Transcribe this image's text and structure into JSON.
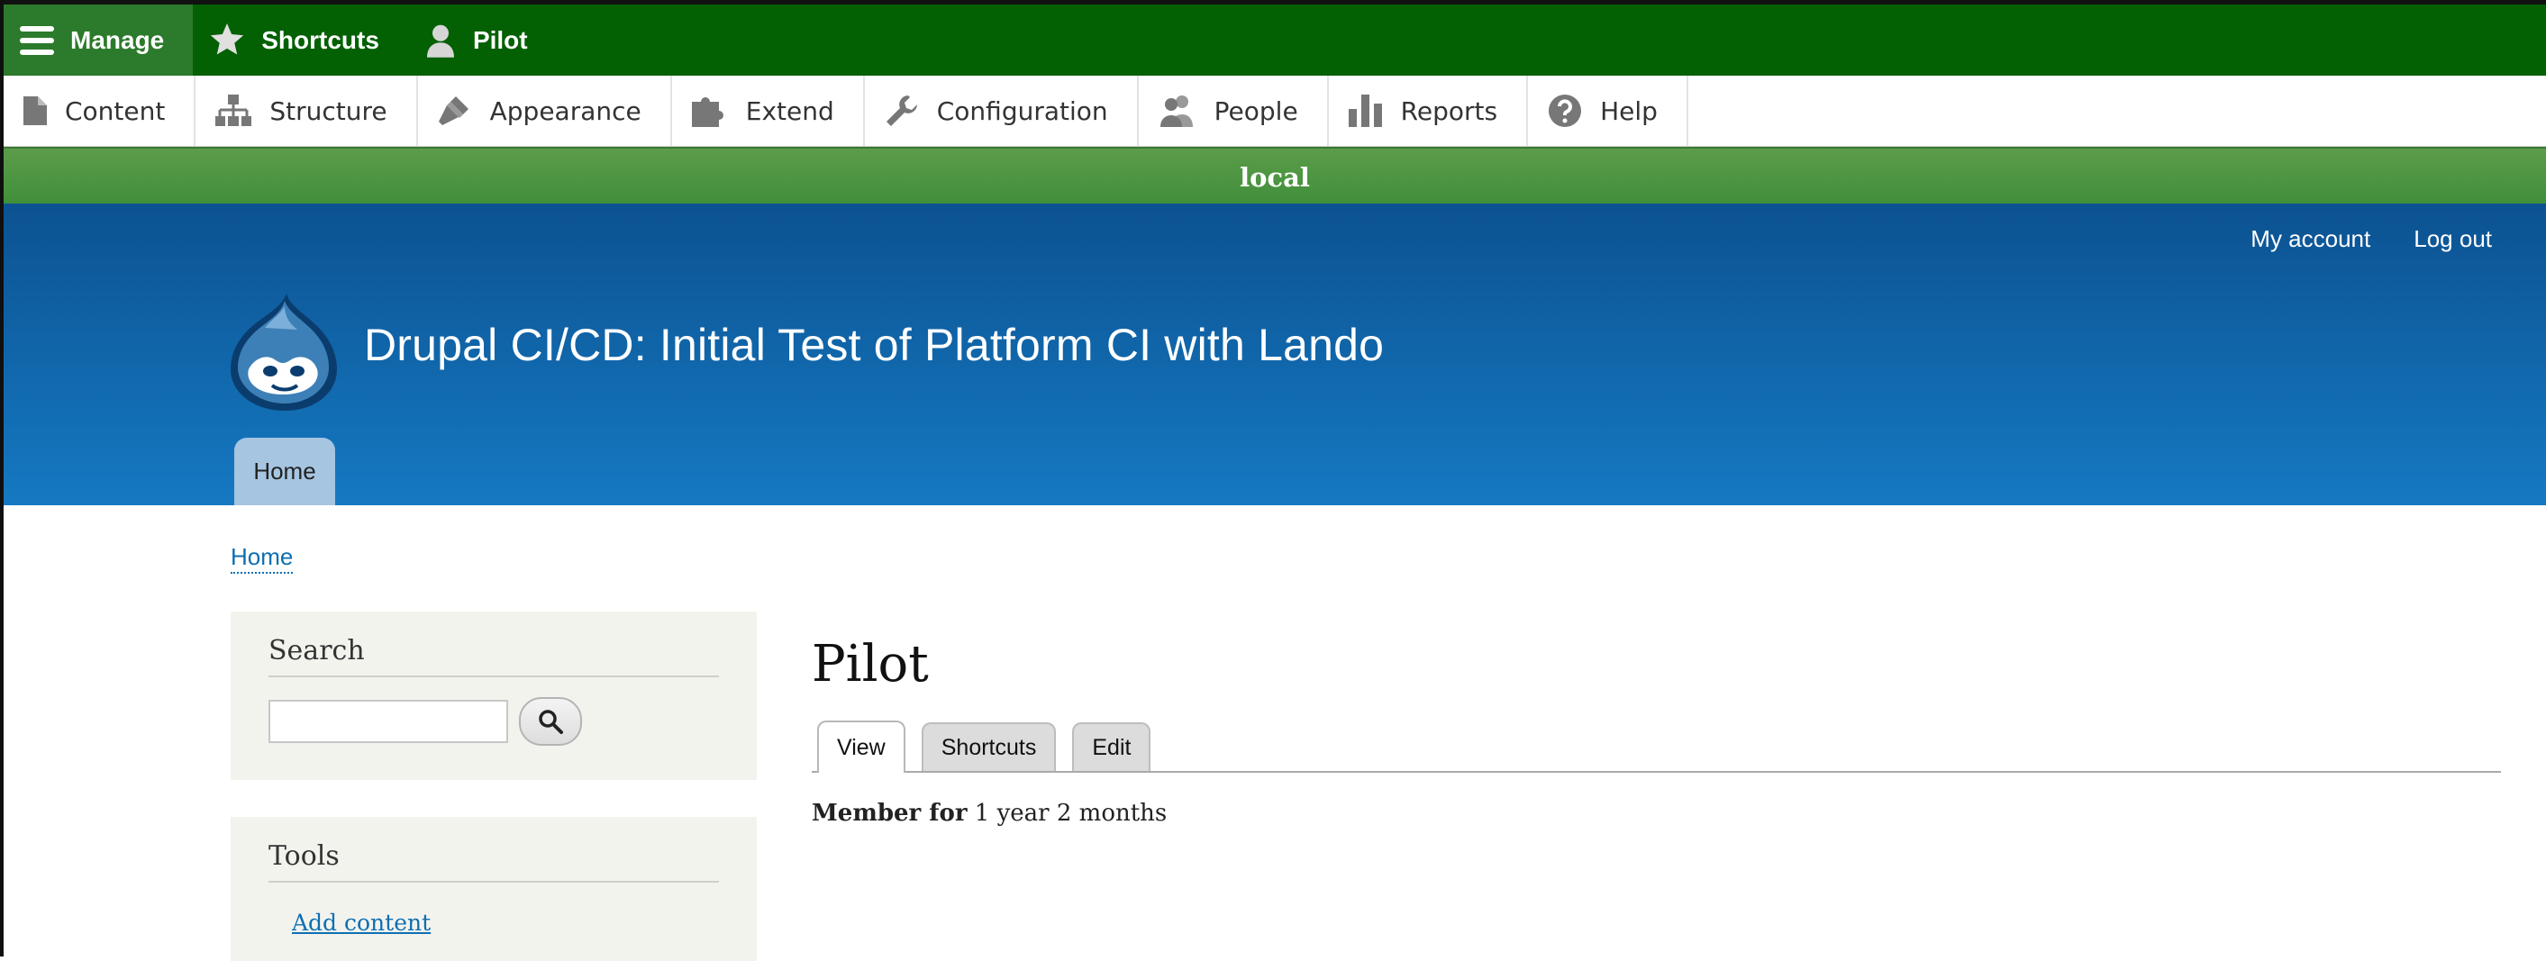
{
  "toolbar": {
    "tabs": [
      {
        "label": "Manage",
        "icon": "hamburger-icon"
      },
      {
        "label": "Shortcuts",
        "icon": "star-icon"
      },
      {
        "label": "Pilot",
        "icon": "user-icon"
      }
    ]
  },
  "tray": {
    "items": [
      {
        "label": "Content",
        "icon": "file-icon"
      },
      {
        "label": "Structure",
        "icon": "sitemap-icon"
      },
      {
        "label": "Appearance",
        "icon": "paintbrush-icon"
      },
      {
        "label": "Extend",
        "icon": "puzzle-icon"
      },
      {
        "label": "Configuration",
        "icon": "wrench-icon"
      },
      {
        "label": "People",
        "icon": "people-icon"
      },
      {
        "label": "Reports",
        "icon": "bar-chart-icon"
      },
      {
        "label": "Help",
        "icon": "help-icon"
      }
    ]
  },
  "environment": {
    "label": "local"
  },
  "header": {
    "site_name": "Drupal CI/CD: Initial Test of Platform CI with Lando",
    "secondary_menu": {
      "my_account": "My account",
      "log_out": "Log out"
    },
    "primary_tab": "Home"
  },
  "breadcrumb": {
    "home": "Home"
  },
  "sidebar": {
    "search": {
      "title": "Search",
      "value": ""
    },
    "tools": {
      "title": "Tools",
      "add_content": "Add content"
    }
  },
  "main": {
    "title": "Pilot",
    "tabs": [
      "View",
      "Shortcuts",
      "Edit"
    ],
    "member_label": "Member for",
    "member_value": "1 year 2 months"
  },
  "colors": {
    "toolbar_green": "#036003",
    "env_green": "#4a9440",
    "header_blue_top": "#0c5291",
    "header_blue_bottom": "#1579c2",
    "link_blue": "#0d6fb1"
  }
}
